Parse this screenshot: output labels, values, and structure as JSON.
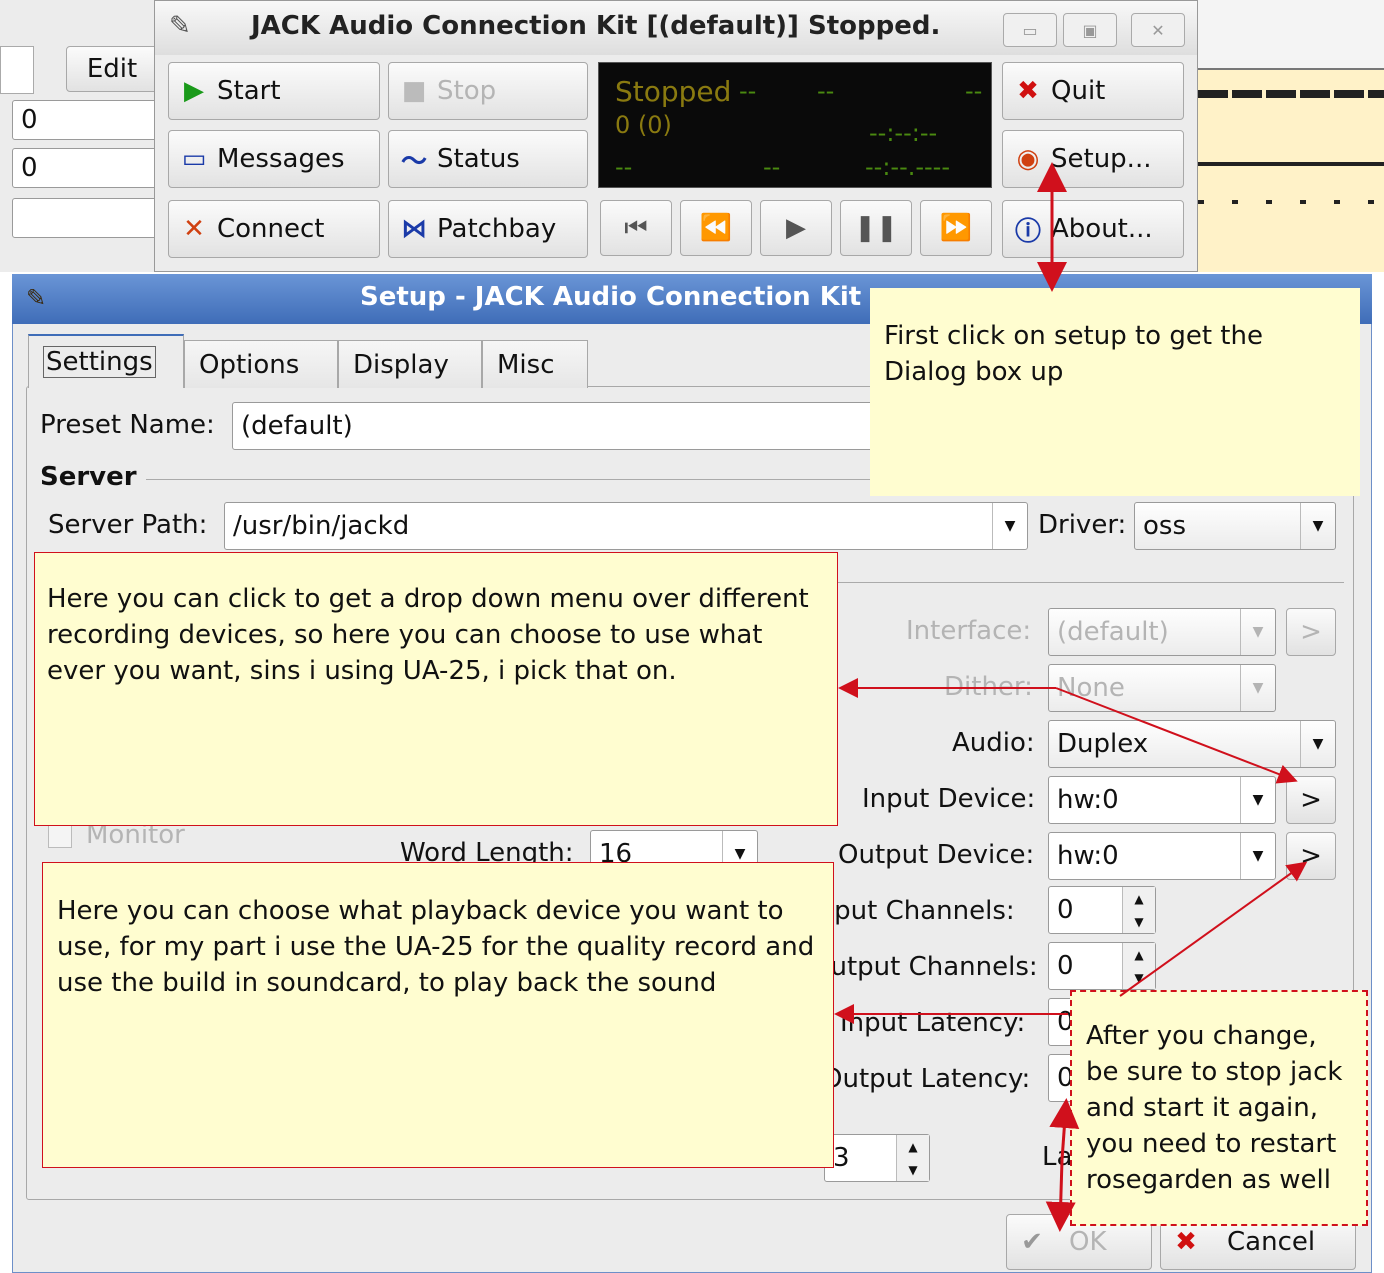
{
  "main_window": {
    "title": "JACK Audio Connection Kit [(default)] Stopped.",
    "buttons": {
      "start": "Start",
      "stop": "Stop",
      "quit": "Quit",
      "messages": "Messages",
      "status": "Status",
      "setup": "Setup...",
      "connect": "Connect",
      "patchbay": "Patchbay",
      "about": "About..."
    },
    "display": {
      "state": "Stopped",
      "dash1": "--",
      "dash2": "--",
      "dash3": "--",
      "xruns": "0 (0)",
      "time1": "--:--:--",
      "dash4": "--",
      "dash5": "--",
      "time2": "--:--.----"
    }
  },
  "background_app": {
    "edit_label": "Edit",
    "value1": "0",
    "value2": "0"
  },
  "setup_dialog": {
    "title": "Setup - JACK Audio Connection Kit",
    "tabs": [
      "Settings",
      "Options",
      "Display",
      "Misc"
    ],
    "preset_label": "Preset Name:",
    "preset_value": "(default)",
    "server_section": "Server",
    "server_path_label": "Server Path:",
    "server_path_value": "/usr/bin/jackd",
    "driver_label": "Driver:",
    "driver_value": "oss",
    "interface_label": "Interface:",
    "interface_value": "(default)",
    "dither_label": "Dither:",
    "dither_value": "None",
    "audio_label": "Audio:",
    "audio_value": "Duplex",
    "input_device_label": "Input Device:",
    "input_device_value": "hw:0",
    "output_device_label": "Output Device:",
    "output_device_value": "hw:0",
    "input_channels_label": "Input Channels:",
    "input_channels_value": "0",
    "output_channels_label": "Output Channels:",
    "output_channels_value": "0",
    "input_latency_label": "Input Latency:",
    "input_latency_value": "0",
    "output_latency_label": "Output Latency:",
    "output_latency_value": "0",
    "monitor_label": "Monitor",
    "word_length_label": "Word Length:",
    "word_length_value": "16",
    "periods_value": "3",
    "latency_label": "La",
    "device_select_glyph": ">",
    "ok_label": "OK",
    "cancel_label": "Cancel"
  },
  "annotations": {
    "setup_note": "First click on setup to get the Dialog box up",
    "input_note": "Here you can click to get a drop down menu over different recording devices, so here you can choose to use what ever you want, sins i using UA-25, i pick that on.",
    "output_note": "Here you can choose what playback device you want to use, for my part i use the UA-25 for the quality record and use the build in soundcard, to play back the sound",
    "restart_note": "After you change, be sure to stop jack and start it again, you need to restart rosegarden as well"
  },
  "colors": {
    "titlebar": "#4a79c4",
    "note_bg": "#fffdd0",
    "arrow": "#d0101c",
    "display_bg": "#0a0a0a",
    "display_text": "#4a8a10"
  }
}
